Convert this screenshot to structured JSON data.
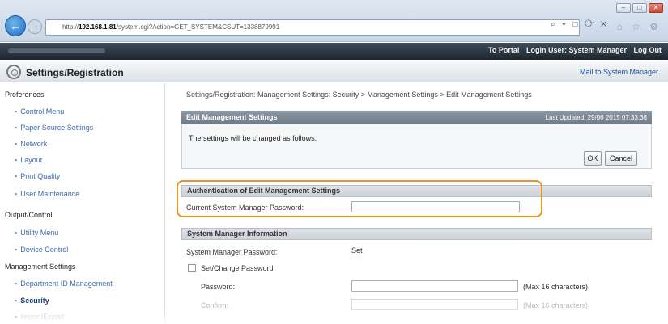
{
  "browser": {
    "url_scheme": "http://",
    "url_host": "192.168.1.81",
    "url_path": "/system.cgi?Action=GET_SYSTEM&CSUT=1338879991",
    "toolbar_glyphs": "⌕ ▾ □ ⟳ ✕",
    "tab_glyphs": "⌂ ☆ ⚙",
    "win_min": "–",
    "win_max": "□",
    "win_close": "✕"
  },
  "topbar": {
    "portal": "To Portal",
    "login_user": "Login User: System Manager",
    "logout": "Log Out"
  },
  "title": {
    "text": "Settings/Registration",
    "mail_link": "Mail to System Manager"
  },
  "sidebar": {
    "preferences": "Preferences",
    "preferences_items": [
      "Control Menu",
      "Paper Source Settings",
      "Network",
      "Layout",
      "Print Quality",
      "User Maintenance"
    ],
    "output_control": "Output/Control",
    "output_items": [
      "Utility Menu",
      "Device Control"
    ],
    "management": "Management Settings",
    "management_items": [
      "Department ID Management",
      "Security",
      "Import/Export"
    ],
    "bullet": "▪"
  },
  "main": {
    "breadcrumb": "Settings/Registration: Management Settings: Security > Management Settings > Edit Management Settings",
    "panel_title": "Edit Management Settings",
    "last_updated": "Last Updated: 29/06 2015 07:33:36",
    "message": "The settings will be changed as follows.",
    "ok_label": "OK",
    "cancel_label": "Cancel",
    "auth_section": "Authentication of Edit Management Settings",
    "current_pw_label": "Current System Manager Password:",
    "current_pw_value": "",
    "sysmgr_section": "System Manager Information",
    "sysmgr_pw_label": "System Manager Password:",
    "sysmgr_pw_value": "Set",
    "set_change_label": "Set/Change Password",
    "password_label": "Password:",
    "password_value": "",
    "password_hint": "(Max 16 characters)",
    "confirm_label": "Confirm:",
    "confirm_value": "",
    "confirm_hint": "(Max 16 characters)"
  }
}
